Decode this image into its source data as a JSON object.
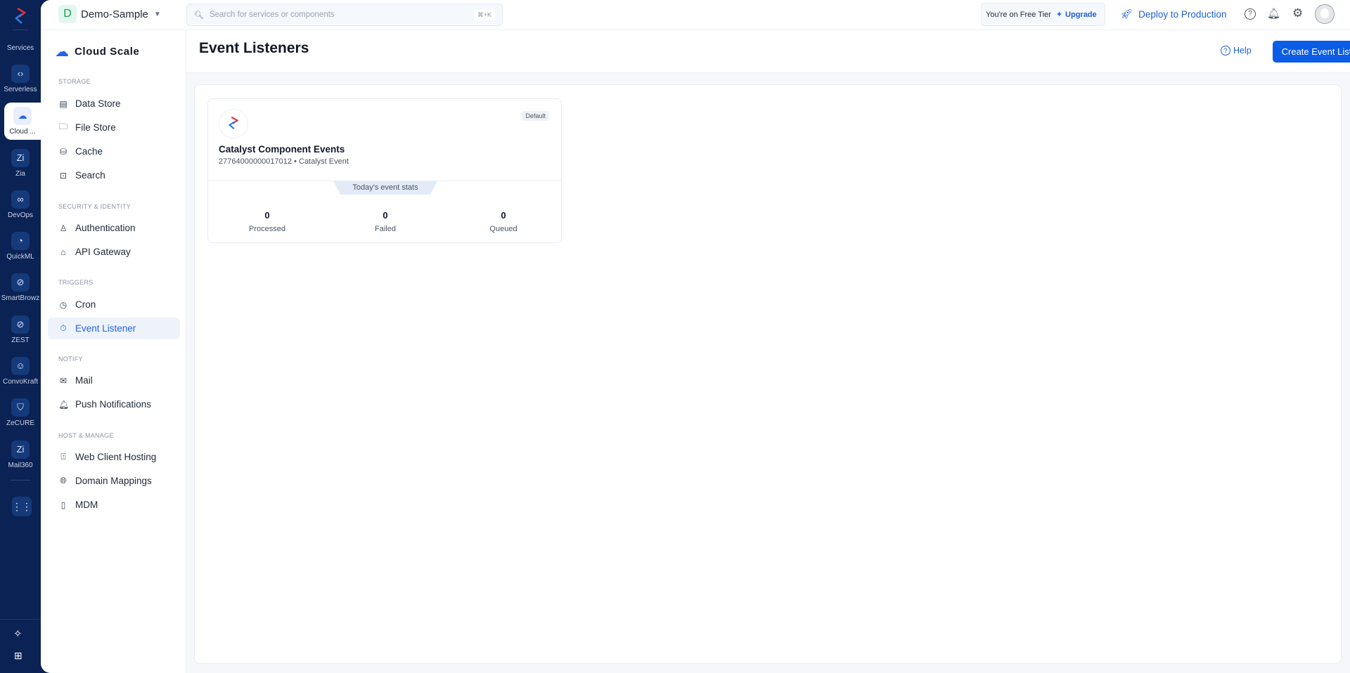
{
  "rail": {
    "services_label": "Services",
    "items": [
      {
        "label": "Serverless",
        "icon": "serverless-icon",
        "glyph": "‹›"
      },
      {
        "label": "Cloud ...",
        "icon": "cloud-scale-icon",
        "glyph": "☁"
      },
      {
        "label": "Zia",
        "icon": "zia-icon",
        "glyph": "Zi"
      },
      {
        "label": "DevOps",
        "icon": "devops-icon",
        "glyph": "∞"
      },
      {
        "label": "QuickML",
        "icon": "quickml-icon",
        "glyph": "◔"
      },
      {
        "label": "SmartBrowz",
        "icon": "smartbrowz-icon",
        "glyph": "⊘"
      },
      {
        "label": "ZEST",
        "icon": "zest-icon",
        "glyph": "⊘"
      },
      {
        "label": "ConvoKraft",
        "icon": "convokraft-icon",
        "glyph": "☺"
      },
      {
        "label": "ZeCURE",
        "icon": "zecure-icon",
        "glyph": "⛉"
      },
      {
        "label": "Mail360",
        "icon": "mail360-icon",
        "glyph": "Zi"
      }
    ]
  },
  "topbar": {
    "project_initial": "D",
    "project_name": "Demo-Sample",
    "search_placeholder": "Search for services or components",
    "search_shortcut": "⌘+K",
    "tier_text": "You're on Free Tier",
    "upgrade_label": "Upgrade",
    "deploy_label": "Deploy to Production"
  },
  "sidebar": {
    "title": "Cloud Scale",
    "sections": [
      {
        "header": "STORAGE",
        "items": [
          "Data Store",
          "File Store",
          "Cache",
          "Search"
        ]
      },
      {
        "header": "SECURITY & IDENTITY",
        "items": [
          "Authentication",
          "API Gateway"
        ]
      },
      {
        "header": "TRIGGERS",
        "items": [
          "Cron",
          "Event Listener"
        ]
      },
      {
        "header": "NOTIFY",
        "items": [
          "Mail",
          "Push Notifications"
        ]
      },
      {
        "header": "HOST & MANAGE",
        "items": [
          "Web Client Hosting",
          "Domain Mappings",
          "MDM"
        ]
      }
    ]
  },
  "page": {
    "title": "Event Listeners",
    "help_label": "Help",
    "create_label": "Create Event Listener"
  },
  "card": {
    "badge": "Default",
    "title": "Catalyst Component Events",
    "id": "27764000000017012",
    "type": "Catalyst Event",
    "stats_label": "Today's event stats",
    "stats": [
      {
        "value": "0",
        "label": "Processed"
      },
      {
        "value": "0",
        "label": "Failed"
      },
      {
        "value": "0",
        "label": "Queued"
      }
    ]
  },
  "colors": {
    "primary": "#0b5ce6",
    "rail": "#0b2254"
  }
}
